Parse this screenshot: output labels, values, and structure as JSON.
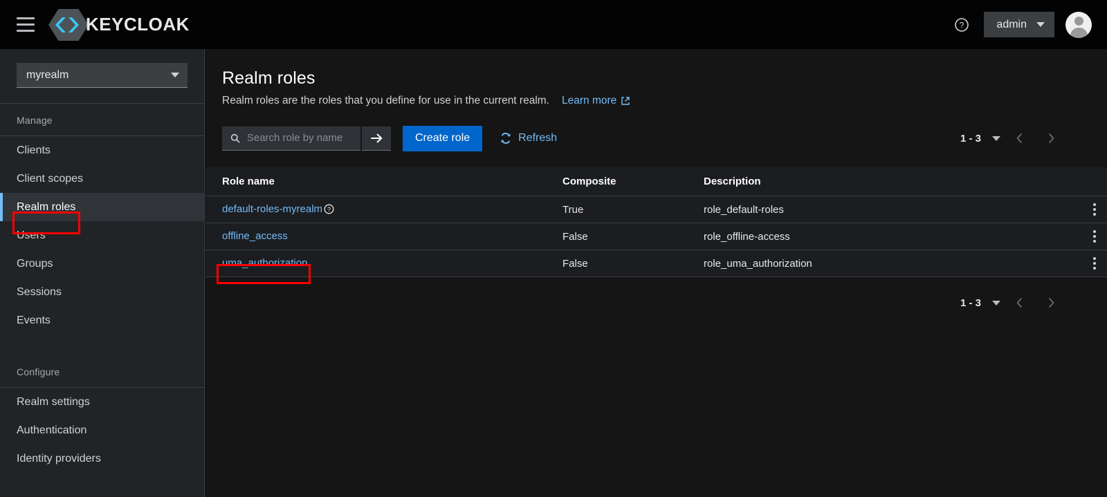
{
  "masthead": {
    "menu_icon": "hamburger-menu-icon",
    "brand_name": "KEYCLOAK",
    "help_icon": "help-circle-icon",
    "user_name": "admin",
    "user_caret_icon": "chevron-down-icon",
    "avatar_icon": "user-avatar-icon"
  },
  "sidebar": {
    "realm_selector": {
      "value": "myrealm",
      "caret_icon": "chevron-down-icon"
    },
    "sections": [
      {
        "title": "Manage",
        "items": [
          {
            "label": "Clients",
            "active": false
          },
          {
            "label": "Client scopes",
            "active": false
          },
          {
            "label": "Realm roles",
            "active": true
          },
          {
            "label": "Users",
            "active": false
          },
          {
            "label": "Groups",
            "active": false
          },
          {
            "label": "Sessions",
            "active": false
          },
          {
            "label": "Events",
            "active": false
          }
        ]
      },
      {
        "title": "Configure",
        "items": [
          {
            "label": "Realm settings",
            "active": false
          },
          {
            "label": "Authentication",
            "active": false
          },
          {
            "label": "Identity providers",
            "active": false
          }
        ]
      }
    ]
  },
  "main": {
    "title": "Realm roles",
    "subtitle": "Realm roles are the roles that you define for use in the current realm.",
    "learn_more_label": "Learn more",
    "learn_more_icon": "external-link-icon",
    "toolbar": {
      "search_placeholder": "Search role by name",
      "search_value": "",
      "search_icon": "search-icon",
      "search_submit_icon": "arrow-right-icon",
      "create_label": "Create role",
      "refresh_label": "Refresh",
      "refresh_icon": "sync-refresh-icon"
    },
    "pagination": {
      "range": "1 - 3",
      "caret_icon": "chevron-down-icon",
      "prev_icon": "chevron-left-icon",
      "next_icon": "chevron-right-icon"
    },
    "table": {
      "columns": [
        "Role name",
        "Composite",
        "Description"
      ],
      "rows": [
        {
          "name": "default-roles-myrealm",
          "has_help_icon": true,
          "help_icon": "help-circle-icon",
          "composite": "True",
          "description": "role_default-roles",
          "kebab_icon": "kebab-menu-icon"
        },
        {
          "name": "offline_access",
          "has_help_icon": false,
          "help_icon": "",
          "composite": "False",
          "description": "role_offline-access",
          "kebab_icon": "kebab-menu-icon"
        },
        {
          "name": "uma_authorization",
          "has_help_icon": false,
          "help_icon": "",
          "composite": "False",
          "description": "role_uma_authorization",
          "kebab_icon": "kebab-menu-icon"
        }
      ]
    }
  },
  "colors": {
    "accent_blue": "#0066cc",
    "link_blue": "#73bcf7",
    "annotation_red": "#ff0000",
    "masthead_bg": "#030303",
    "sidebar_bg": "#212427",
    "page_bg": "#151515",
    "table_bg": "#1b1d21"
  }
}
